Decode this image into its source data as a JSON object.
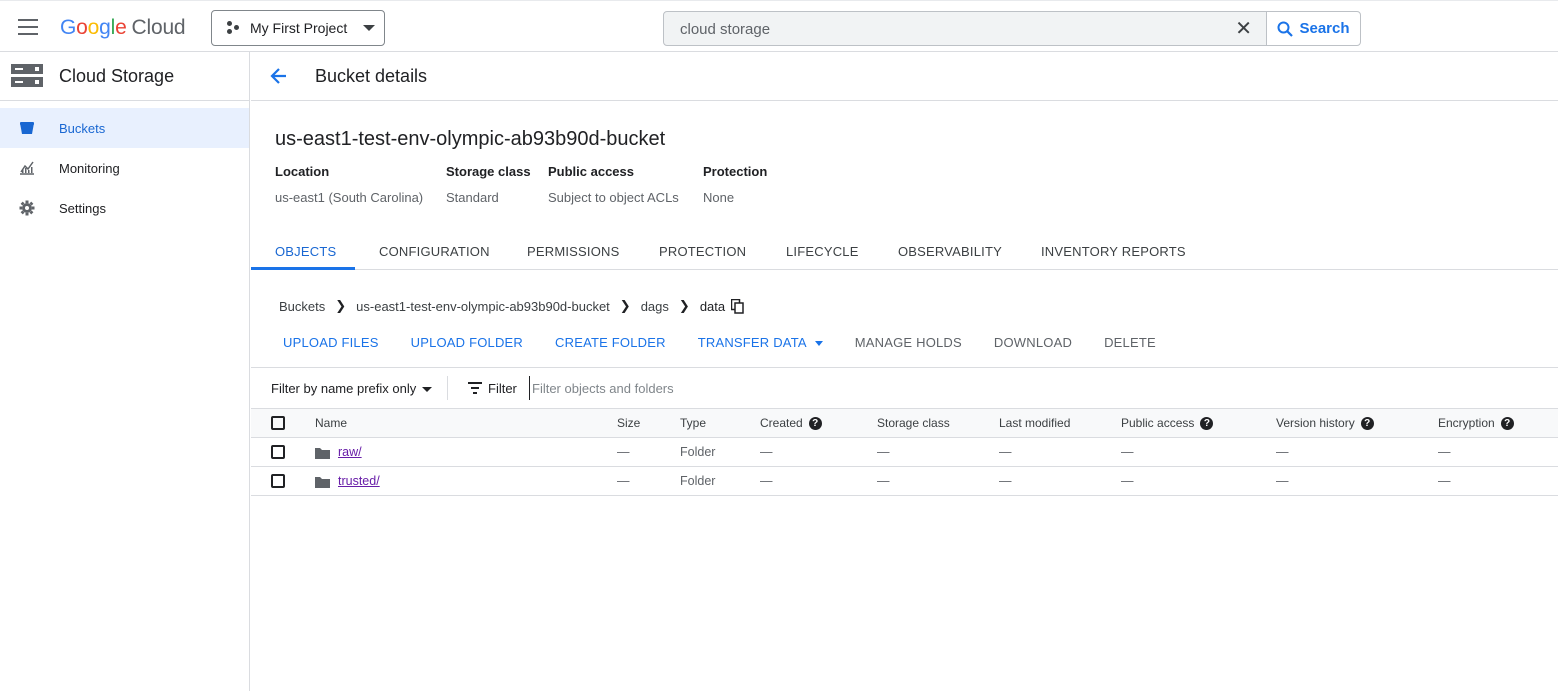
{
  "header": {
    "logo": {
      "g1": "G",
      "g2": "o",
      "g3": "o",
      "g4": "g",
      "g5": "l",
      "g6": "e",
      "cloud": "Cloud"
    },
    "project": "My First Project",
    "search": {
      "value": "cloud storage",
      "clear": "✕",
      "button": "Search"
    }
  },
  "sidebar": {
    "title": "Cloud Storage",
    "items": [
      {
        "label": "Buckets",
        "icon": "bucket-icon",
        "active": true
      },
      {
        "label": "Monitoring",
        "icon": "chart-icon",
        "active": false
      },
      {
        "label": "Settings",
        "icon": "gear-icon",
        "active": false
      }
    ]
  },
  "page": {
    "title": "Bucket details",
    "bucket_name": "us-east1-test-env-olympic-ab93b90d-bucket",
    "meta": [
      {
        "key": "Location",
        "value": "us-east1 (South Carolina)"
      },
      {
        "key": "Storage class",
        "value": "Standard"
      },
      {
        "key": "Public access",
        "value": "Subject to object ACLs"
      },
      {
        "key": "Protection",
        "value": "None"
      }
    ],
    "tabs": [
      "OBJECTS",
      "CONFIGURATION",
      "PERMISSIONS",
      "PROTECTION",
      "LIFECYCLE",
      "OBSERVABILITY",
      "INVENTORY REPORTS"
    ],
    "active_tab": "OBJECTS",
    "breadcrumb": [
      "Buckets",
      "us-east1-test-env-olympic-ab93b90d-bucket",
      "dags",
      "data"
    ],
    "actions": {
      "upload_files": "UPLOAD FILES",
      "upload_folder": "UPLOAD FOLDER",
      "create_folder": "CREATE FOLDER",
      "transfer_data": "TRANSFER DATA",
      "manage_holds": "MANAGE HOLDS",
      "download": "DOWNLOAD",
      "delete": "DELETE"
    },
    "filter": {
      "mode": "Filter by name prefix only",
      "label": "Filter",
      "placeholder": "Filter objects and folders"
    },
    "table": {
      "columns": [
        "Name",
        "Size",
        "Type",
        "Created",
        "Storage class",
        "Last modified",
        "Public access",
        "Version history",
        "Encryption"
      ],
      "rows": [
        {
          "name": "raw/",
          "size": "—",
          "type": "Folder",
          "created": "—",
          "storage_class": "—",
          "last_modified": "—",
          "public_access": "—",
          "version_history": "—",
          "encryption": "—"
        },
        {
          "name": "trusted/",
          "size": "—",
          "type": "Folder",
          "created": "—",
          "storage_class": "—",
          "last_modified": "—",
          "public_access": "—",
          "version_history": "—",
          "encryption": "—"
        }
      ]
    }
  },
  "colors": {
    "accent": "#1a73e8",
    "active_nav_bg": "#e8f0fe",
    "visited_link": "#681da8"
  }
}
